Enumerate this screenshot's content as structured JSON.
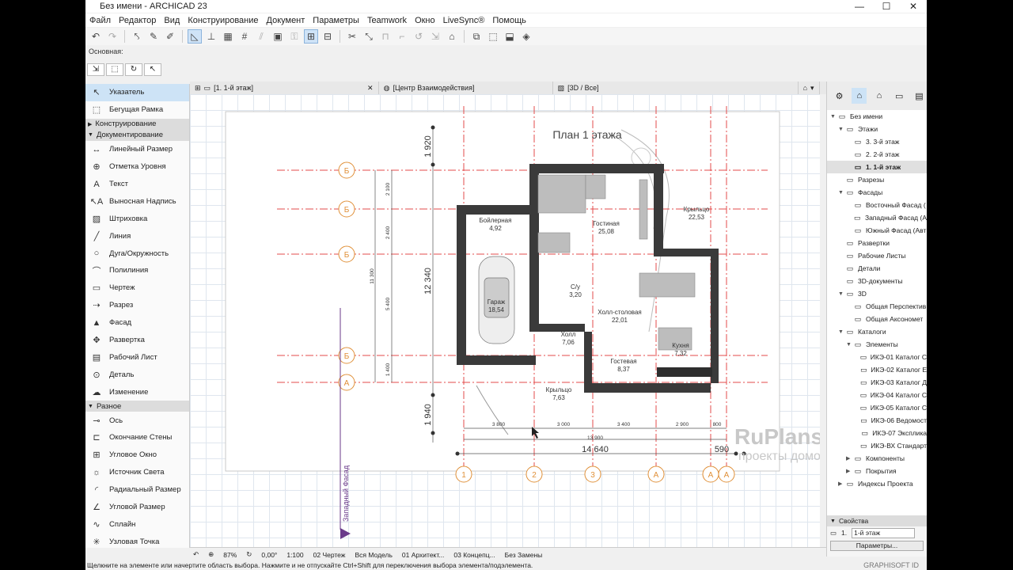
{
  "window": {
    "title": "Без имени - ARCHICAD 23"
  },
  "menu": [
    "Файл",
    "Редактор",
    "Вид",
    "Конструирование",
    "Документ",
    "Параметры",
    "Teamwork",
    "Окно",
    "LiveSync®",
    "Помощь"
  ],
  "infobox": {
    "label": "Основная:"
  },
  "toolbox": {
    "top_tools": [
      {
        "label": "Указатель",
        "icon": "arrow-pointer-icon"
      },
      {
        "label": "Бегущая Рамка",
        "icon": "marquee-icon"
      }
    ],
    "group_construct": "Конструирование",
    "group_document": "Документирование",
    "document_tools": [
      {
        "label": "Линейный Размер",
        "icon": "dimension-icon"
      },
      {
        "label": "Отметка Уровня",
        "icon": "level-icon"
      },
      {
        "label": "Текст",
        "icon": "text-icon"
      },
      {
        "label": "Выносная Надпись",
        "icon": "label-icon"
      },
      {
        "label": "Штриховка",
        "icon": "fill-icon"
      },
      {
        "label": "Линия",
        "icon": "line-icon"
      },
      {
        "label": "Дуга/Окружность",
        "icon": "arc-icon"
      },
      {
        "label": "Полилиния",
        "icon": "polyline-icon"
      },
      {
        "label": "Чертеж",
        "icon": "drawing-icon"
      },
      {
        "label": "Разрез",
        "icon": "section-icon"
      },
      {
        "label": "Фасад",
        "icon": "elevation-icon"
      },
      {
        "label": "Развертка",
        "icon": "interior-elevation-icon"
      },
      {
        "label": "Рабочий Лист",
        "icon": "worksheet-icon"
      },
      {
        "label": "Деталь",
        "icon": "detail-icon"
      },
      {
        "label": "Изменение",
        "icon": "change-icon"
      }
    ],
    "group_misc": "Разное",
    "misc_tools": [
      {
        "label": "Ось",
        "icon": "grid-axis-icon"
      },
      {
        "label": "Окончание Стены",
        "icon": "wall-end-icon"
      },
      {
        "label": "Угловое Окно",
        "icon": "corner-window-icon"
      },
      {
        "label": "Источник Света",
        "icon": "lamp-icon"
      },
      {
        "label": "Радиальный Размер",
        "icon": "radial-dimension-icon"
      },
      {
        "label": "Угловой Размер",
        "icon": "angle-dimension-icon"
      },
      {
        "label": "Сплайн",
        "icon": "spline-icon"
      },
      {
        "label": "Узловая Точка",
        "icon": "hotspot-icon"
      }
    ]
  },
  "tabs": [
    {
      "label": "[1. 1-й этаж]",
      "active": true
    },
    {
      "label": "[Центр Взаимодействия]",
      "active": false
    },
    {
      "label": "[3D / Все]",
      "active": false
    }
  ],
  "plan": {
    "title": "План 1 этажа",
    "rooms": [
      {
        "name": "Бойлерная",
        "area": "4,92"
      },
      {
        "name": "Гостиная",
        "area": "25,08"
      },
      {
        "name": "Крыльцо",
        "area": "22,53"
      },
      {
        "name": "С/у",
        "area": "3,20"
      },
      {
        "name": "Гараж",
        "area": "18,54"
      },
      {
        "name": "Холл-столовая",
        "area": "22,01"
      },
      {
        "name": "Холл",
        "area": "7,06"
      },
      {
        "name": "Кухня",
        "area": "7,32"
      },
      {
        "name": "Гостевая",
        "area": "8,37"
      },
      {
        "name": "Крыльцо",
        "area": "7,63"
      }
    ],
    "axes_left": [
      "Б",
      "Б",
      "Б",
      "Б",
      "А"
    ],
    "axes_bottom": [
      "1",
      "2",
      "3",
      "А",
      "А",
      "А"
    ],
    "dims_bottom_small": [
      "3 800",
      "3 000",
      "3 400",
      "2 900",
      "800"
    ],
    "dim_total_inner": "13 900",
    "dim_total": "14 640",
    "dim_extra": "590",
    "dims_left_small": [
      "2 100",
      "2 400",
      "5 400",
      "1 400"
    ],
    "dim_left_total": "11 300",
    "dim_left_big": "12 340",
    "dim_top": "1 920",
    "dim_bottom": "1 940",
    "facade_label": "Западный Фасад",
    "watermark_title": "RuPlans",
    "watermark_subtitle": "проекты домов"
  },
  "navigator": {
    "items": [
      {
        "label": "Без имени",
        "level": 0,
        "icon": "project-icon",
        "twisty": "v"
      },
      {
        "label": "Этажи",
        "level": 1,
        "icon": "stories-icon",
        "twisty": "v"
      },
      {
        "label": "3. 3-й этаж",
        "level": 2,
        "icon": "story-icon",
        "twisty": ""
      },
      {
        "label": "2. 2-й этаж",
        "level": 2,
        "icon": "story-icon",
        "twisty": ""
      },
      {
        "label": "1. 1-й этаж",
        "level": 2,
        "icon": "story-icon",
        "twisty": "",
        "selected": true
      },
      {
        "label": "Разрезы",
        "level": 1,
        "icon": "sections-icon",
        "twisty": ""
      },
      {
        "label": "Фасады",
        "level": 1,
        "icon": "elevations-icon",
        "twisty": "v"
      },
      {
        "label": "Восточный Фасад (",
        "level": 2,
        "icon": "elevation-item-icon",
        "twisty": ""
      },
      {
        "label": "Западный Фасад (А",
        "level": 2,
        "icon": "elevation-item-icon",
        "twisty": ""
      },
      {
        "label": "Южный Фасад (Авт",
        "level": 2,
        "icon": "elevation-item-icon",
        "twisty": ""
      },
      {
        "label": "Развертки",
        "level": 1,
        "icon": "interior-icon",
        "twisty": ""
      },
      {
        "label": "Рабочие Листы",
        "level": 1,
        "icon": "worksheets-icon",
        "twisty": ""
      },
      {
        "label": "Детали",
        "level": 1,
        "icon": "details-icon",
        "twisty": ""
      },
      {
        "label": "3D-документы",
        "level": 1,
        "icon": "3d-docs-icon",
        "twisty": ""
      },
      {
        "label": "3D",
        "level": 1,
        "icon": "3d-icon",
        "twisty": "v"
      },
      {
        "label": "Общая Перспектив",
        "level": 2,
        "icon": "perspective-icon",
        "twisty": ""
      },
      {
        "label": "Общая Аксономет",
        "level": 2,
        "icon": "axonometry-icon",
        "twisty": ""
      },
      {
        "label": "Каталоги",
        "level": 1,
        "icon": "schedules-icon",
        "twisty": "v"
      },
      {
        "label": "Элементы",
        "level": 2,
        "icon": "elements-icon",
        "twisty": "v"
      },
      {
        "label": "ИКЭ-01 Каталог С",
        "level": 3,
        "icon": "schedule-icon",
        "twisty": ""
      },
      {
        "label": "ИКЭ-02 Каталог Е",
        "level": 3,
        "icon": "schedule-icon",
        "twisty": ""
      },
      {
        "label": "ИКЭ-03 Каталог Д",
        "level": 3,
        "icon": "schedule-icon",
        "twisty": ""
      },
      {
        "label": "ИКЭ-04 Каталог С",
        "level": 3,
        "icon": "schedule-icon",
        "twisty": ""
      },
      {
        "label": "ИКЭ-05 Каталог С",
        "level": 3,
        "icon": "schedule-icon",
        "twisty": ""
      },
      {
        "label": "ИКЭ-06 Ведомост",
        "level": 3,
        "icon": "schedule-icon",
        "twisty": ""
      },
      {
        "label": "ИКЭ-07 Экспликa",
        "level": 3,
        "icon": "schedule-icon",
        "twisty": ""
      },
      {
        "label": "ИКЭ-ВХ Стандарт",
        "level": 3,
        "icon": "schedule-icon",
        "twisty": ""
      },
      {
        "label": "Компоненты",
        "level": 2,
        "icon": "components-icon",
        "twisty": ">"
      },
      {
        "label": "Покрытия",
        "level": 2,
        "icon": "surfaces-icon",
        "twisty": ">"
      },
      {
        "label": "Индексы Проекта",
        "level": 1,
        "icon": "index-icon",
        "twisty": ">"
      }
    ]
  },
  "properties": {
    "header": "Свойства",
    "story_num": "1.",
    "story_value": "1-й этаж",
    "button": "Параметры..."
  },
  "status": {
    "zoom": "87%",
    "angle": "0,00°",
    "scale": "1:100",
    "layer_combo": "02 Чертеж",
    "model_view": "Вся Модель",
    "pen_set": "01 Архитект...",
    "renovation": "03 Концепц...",
    "changes": "Без Замены"
  },
  "hint": "Щелкните на элементе или начертите область выбора. Нажмите и не отпускайте Ctrl+Shift для переключения выбора элемента/подэлемента.",
  "brand": "GRAPHISOFT ID"
}
